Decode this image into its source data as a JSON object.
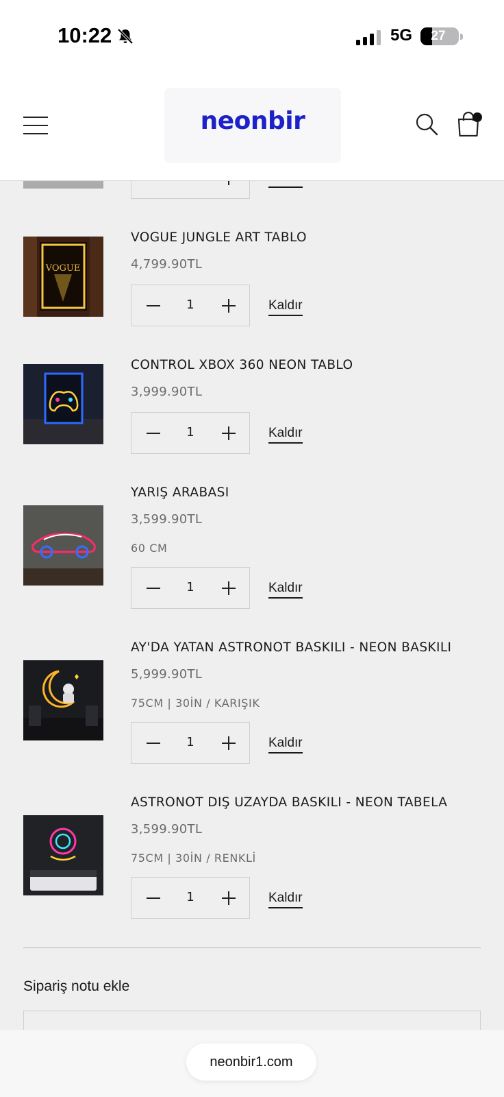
{
  "status_bar": {
    "time": "10:22",
    "network": "5G",
    "battery": "27"
  },
  "header": {
    "logo": "neonbir"
  },
  "cart": {
    "items": [
      {
        "title": "",
        "price": "",
        "variant": "",
        "quantity": "",
        "remove_label": "Kaldır"
      },
      {
        "title": "VOGUE JUNGLE ART TABLO",
        "price": "4,799.90TL",
        "variant": "",
        "quantity": "1",
        "remove_label": "Kaldır"
      },
      {
        "title": "CONTROL XBOX 360 NEON TABLO",
        "price": "3,999.90TL",
        "variant": "",
        "quantity": "1",
        "remove_label": "Kaldır"
      },
      {
        "title": "YARIŞ ARABASI",
        "price": "3,599.90TL",
        "variant": "60 CM",
        "quantity": "1",
        "remove_label": "Kaldır"
      },
      {
        "title": "AY'DA YATAN ASTRONOT BASKILI - NEON BASKILI",
        "price": "5,999.90TL",
        "variant": "75CM | 30İN / KARIŞIK",
        "quantity": "1",
        "remove_label": "Kaldır"
      },
      {
        "title": "ASTRONOT DIŞ UZAYDA BASKILI - NEON TABELA",
        "price": "3,599.90TL",
        "variant": "75CM | 30İN / RENKLİ",
        "quantity": "1",
        "remove_label": "Kaldır"
      }
    ]
  },
  "order_note": {
    "label": "Sipariş notu ekle"
  },
  "browser": {
    "url": "neonbir1.com"
  },
  "colors": {
    "brand": "#1d22c8",
    "background": "#efeff0"
  }
}
